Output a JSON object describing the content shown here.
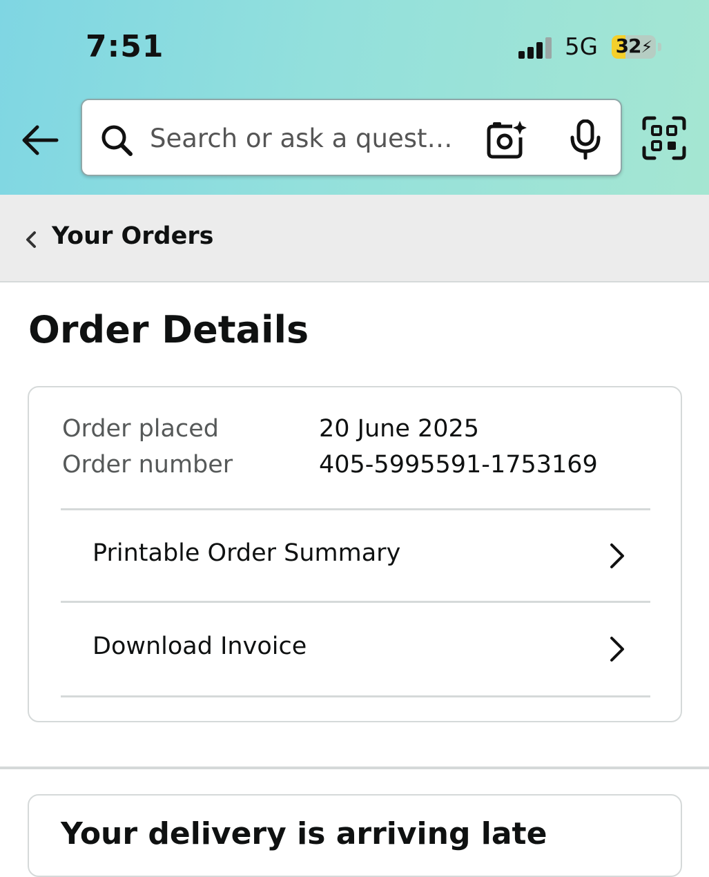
{
  "status_bar": {
    "time": "7:51",
    "network": "5G",
    "battery_level": "32",
    "battery_fraction": 0.32,
    "battery_color": "#f4cf2b"
  },
  "header": {
    "back_icon": "back-arrow-icon",
    "search": {
      "placeholder": "Search or ask a quest…",
      "value": ""
    },
    "camera_icon": "camera-sparkle-icon",
    "mic_icon": "microphone-icon",
    "scan_icon": "qr-scan-icon",
    "gradient_colors": [
      "#7fd6e3",
      "#a5e6d2"
    ]
  },
  "breadcrumb": {
    "label": "Your Orders"
  },
  "page": {
    "title": "Order Details"
  },
  "order": {
    "placed_label": "Order placed",
    "placed_value": "20 June 2025",
    "number_label": "Order number",
    "number_value": "405-5995591-1753169",
    "links": [
      {
        "label": "Printable Order Summary"
      },
      {
        "label": "Download Invoice"
      }
    ]
  },
  "next_section": {
    "title": "Your delivery is arriving late"
  }
}
